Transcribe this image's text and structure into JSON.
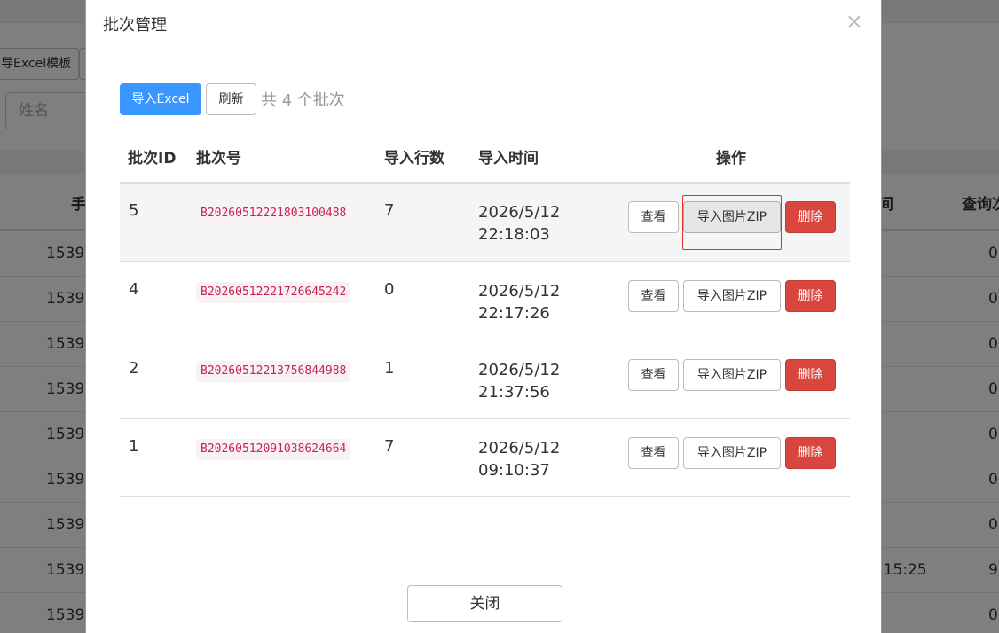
{
  "background": {
    "toolbar": {
      "template_button": "导Excel模板"
    },
    "filter": {
      "name_placeholder": "姓名"
    },
    "table": {
      "header_phone": "手",
      "header_time_partial": "间",
      "header_count": "查询次",
      "rows": [
        {
          "phone": "1539",
          "count": "0"
        },
        {
          "phone": "1539",
          "count": "0"
        },
        {
          "phone": "1539",
          "count": "0"
        },
        {
          "phone": "1539",
          "count": "0"
        },
        {
          "phone": "1539",
          "count": "0"
        },
        {
          "phone": "1539",
          "count": "0"
        },
        {
          "phone": "1539",
          "count": "0"
        },
        {
          "phone": "1539",
          "time": ":15:25",
          "count": "9"
        },
        {
          "phone": "1539",
          "count": "0"
        }
      ]
    }
  },
  "modal": {
    "title": "批次管理",
    "close_icon": "×",
    "toolbar": {
      "import_excel": "导入Excel",
      "refresh": "刷新",
      "count_text": "共 4 个批次"
    },
    "columns": {
      "id": "批次ID",
      "batch_no": "批次号",
      "rows": "导入行数",
      "time": "导入时间",
      "actions": "操作"
    },
    "rows": [
      {
        "id": "5",
        "batch_no": "B20260512221803100488",
        "rows": "7",
        "date": "2026/5/12",
        "time": "22:18:03",
        "view": "查看",
        "zip": "导入图片ZIP",
        "delete": "删除"
      },
      {
        "id": "4",
        "batch_no": "B20260512221726645242",
        "rows": "0",
        "date": "2026/5/12",
        "time": "22:17:26",
        "view": "查看",
        "zip": "导入图片ZIP",
        "delete": "删除"
      },
      {
        "id": "2",
        "batch_no": "B20260512213756844988",
        "rows": "1",
        "date": "2026/5/12",
        "time": "21:37:56",
        "view": "查看",
        "zip": "导入图片ZIP",
        "delete": "删除"
      },
      {
        "id": "1",
        "batch_no": "B20260512091038624664",
        "rows": "7",
        "date": "2026/5/12",
        "time": "09:10:37",
        "view": "查看",
        "zip": "导入图片ZIP",
        "delete": "删除"
      }
    ],
    "footer": {
      "close": "关闭"
    }
  },
  "colors": {
    "primary": "#3a96ff",
    "danger": "#d9463f",
    "batch_text": "#c7254e",
    "batch_bg": "#f9f2f4",
    "highlight_outline": "#e0312e"
  }
}
